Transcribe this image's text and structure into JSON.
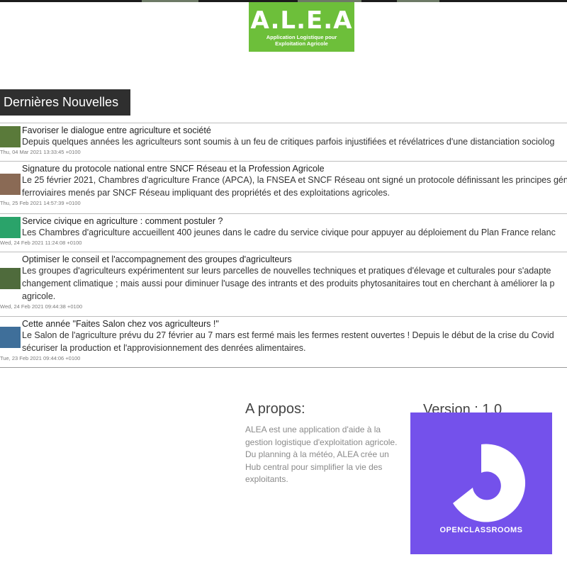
{
  "logo": {
    "name": "A.L.E.A",
    "tagline_line1": "Application Logistique pour",
    "tagline_line2": "Exploitation Agricole",
    "color": "#6dbf3a"
  },
  "news_section": {
    "title": "Dernières Nouvelles",
    "items": [
      {
        "title": "Favoriser le dialogue entre agriculture et société",
        "desc_lines": [
          "Depuis quelques années les agriculteurs sont soumis à un feu de critiques parfois injustifiées et révélatrices d'une distanciation sociolog"
        ],
        "date": "Thu, 04 Mar 2021 13:33:45 +0100",
        "thumb_color": "#5a7a3a"
      },
      {
        "title": "Signature du protocole national entre SNCF Réseau et la Profession Agricole",
        "desc_lines": [
          "Le 25 février 2021, Chambres d'agriculture France (APCA), la FNSEA et SNCF Réseau ont signé un protocole définissant les principes gén",
          "ferroviaires menés par SNCF Réseau impliquant des propriétés et des exploitations agricoles."
        ],
        "date": "Thu, 25 Feb 2021 14:57:39 +0100",
        "thumb_color": "#8a6a55"
      },
      {
        "title": "Service civique en agriculture : comment postuler ?",
        "desc_lines": [
          "Les Chambres d'agriculture accueillent 400 jeunes dans le cadre du service civique pour appuyer au déploiement du Plan France relanc"
        ],
        "date": "Wed, 24 Feb 2021 11:24:08 +0100",
        "thumb_color": "#2aa36a"
      },
      {
        "title": "Optimiser le conseil et l'accompagnement des groupes d'agriculteurs",
        "desc_lines": [
          "Les groupes d'agriculteurs expérimentent sur leurs parcelles de nouvelles techniques et pratiques d'élevage et culturales pour s'adapte",
          "changement climatique ; mais aussi pour diminuer l'usage des intrants et des produits phytosanitaires tout en cherchant à améliorer la p",
          "agricole."
        ],
        "date": "Wed, 24 Feb 2021 09:44:38 +0100",
        "thumb_color": "#4f6b3c"
      },
      {
        "title": "Cette année \"Faites Salon chez vos agriculteurs !\"",
        "desc_lines": [
          "Le Salon de l'agriculture prévu du 27 février au 7 mars est fermé mais les fermes restent ouvertes ! Depuis le début de la crise du Covid",
          "sécuriser la production et l'approvisionnement des denrées alimentaires."
        ],
        "date": "Tue, 23 Feb 2021 09:44:06 +0100",
        "thumb_color": "#3f6f9a"
      }
    ]
  },
  "about": {
    "title": "A propos:",
    "text": "ALEA est une application d'aide à la gestion logistique d'exploitation agricole. Du planning à la météo, ALEA crée un Hub central pour simplifier la vie des exploitants."
  },
  "version": {
    "label": "Version : 1.0"
  },
  "openclassrooms": {
    "label": "OPENCLASSROOMS",
    "color": "#7451eb"
  }
}
